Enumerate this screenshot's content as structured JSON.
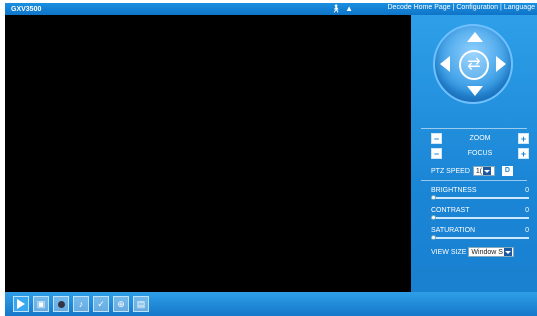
{
  "header": {
    "brand": "GXV3500",
    "icons": [
      "person-icon",
      "alarm-icon"
    ],
    "nav": {
      "decode_home": "Decode Home Page",
      "sep1": "|",
      "configuration": "Configuration",
      "sep2": "|",
      "language": "Language"
    }
  },
  "ptz": {
    "zoom_label": "ZOOM",
    "focus_label": "FOCUS",
    "minus": "−",
    "plus": "+",
    "speed_label": "PTZ SPEED",
    "speed_value": "1(",
    "default_button": "D"
  },
  "image": {
    "brightness_label": "BRIGHTNESS",
    "brightness_value": "0",
    "brightness_level": 0,
    "contrast_label": "CONTRAST",
    "contrast_value": "0",
    "contrast_level": 0,
    "saturation_label": "SATURATION",
    "saturation_value": "0",
    "saturation_level": 0
  },
  "view": {
    "label": "VIEW SIZE",
    "value": "Window S"
  },
  "toolbar": {
    "buttons": [
      "play-icon",
      "snapshot-icon",
      "record-icon",
      "audio-icon",
      "talk-icon",
      "fullscreen-icon",
      "save-icon"
    ]
  }
}
